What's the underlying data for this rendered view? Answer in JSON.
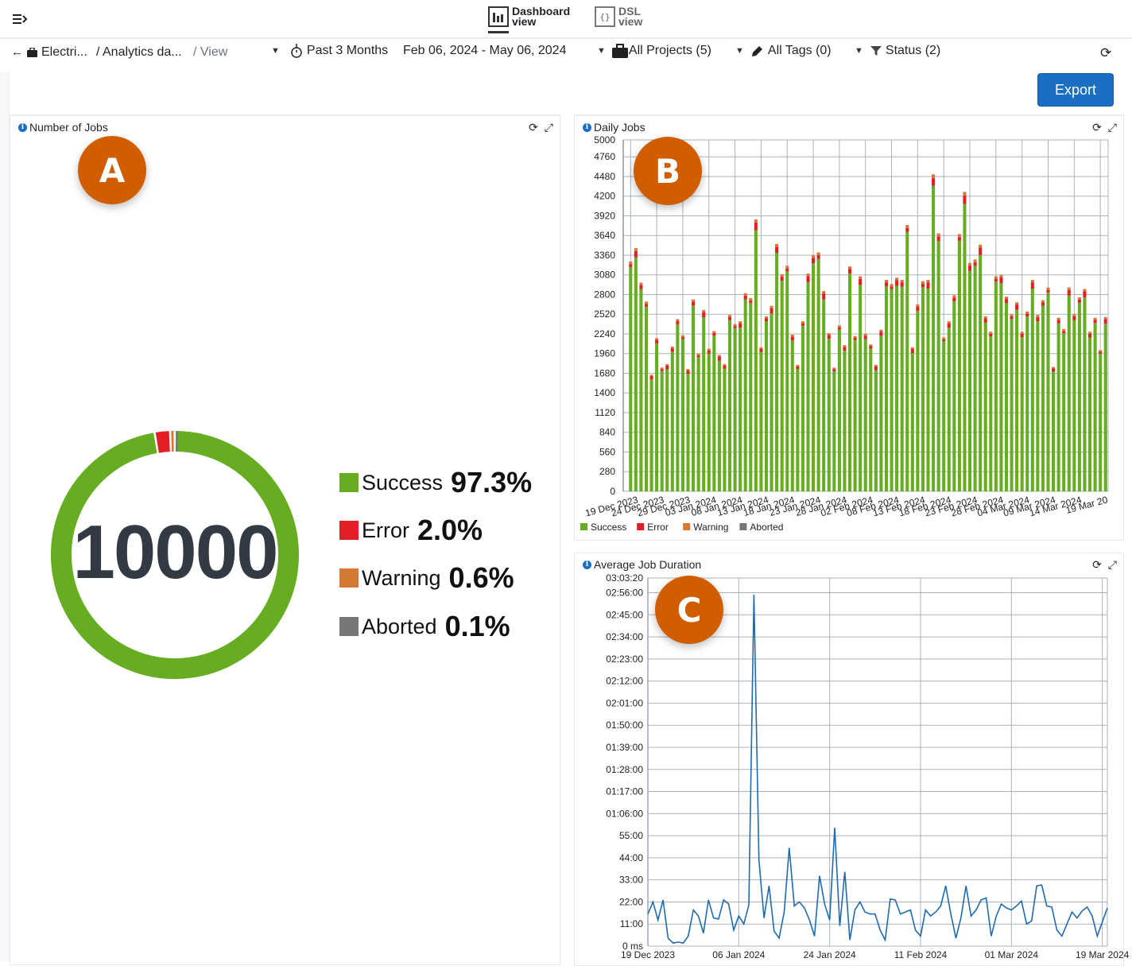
{
  "topbar": {
    "menu_icon": "menu-collapse-icon",
    "tabs": [
      {
        "label": "Dashboard\nview",
        "icon": "bar-chart-icon",
        "active": true
      },
      {
        "label": "DSL\nview",
        "icon": "code-braces-icon",
        "active": false
      }
    ]
  },
  "filterbar": {
    "back_icon": "arrow-left-icon",
    "breadcrumb": [
      {
        "label": "Electri...",
        "icon": "briefcase-icon"
      },
      {
        "label": "/ Analytics da..."
      },
      {
        "label": "/ View"
      }
    ],
    "time_range": {
      "label": "Past 3 Months",
      "icon": "stopwatch-icon",
      "dates": "Feb 06, 2024 - May 06, 2024"
    },
    "projects": {
      "label": "All Projects (5)",
      "icon": "briefcase-icon"
    },
    "tags": {
      "label": "All Tags (0)",
      "icon": "tag-icon"
    },
    "status": {
      "label": "Status (2)",
      "icon": "filter-icon"
    },
    "refresh_icon": "refresh-icon"
  },
  "export_label": "Export",
  "panels": {
    "number_of_jobs": {
      "title": "Number of Jobs",
      "badge": "A",
      "total": "10000",
      "legend": [
        {
          "label": "Success",
          "pct": "97.3%",
          "color": "#66ad22"
        },
        {
          "label": "Error",
          "pct": "2.0%",
          "color": "#e41e26"
        },
        {
          "label": "Warning",
          "pct": "0.6%",
          "color": "#d57834"
        },
        {
          "label": "Aborted",
          "pct": "0.1%",
          "color": "#777777"
        }
      ]
    },
    "daily_jobs": {
      "title": "Daily Jobs",
      "badge": "B"
    },
    "avg_duration": {
      "title": "Average Job Duration",
      "badge": "C"
    }
  },
  "chart_data": [
    {
      "type": "pie",
      "title": "Number of Jobs",
      "center_label": "10000",
      "categories": [
        "Success",
        "Error",
        "Warning",
        "Aborted"
      ],
      "values": [
        97.3,
        2.0,
        0.6,
        0.1
      ],
      "colors": [
        "#66ad22",
        "#e41e26",
        "#d57834",
        "#777777"
      ]
    },
    {
      "type": "bar",
      "stacked": true,
      "title": "Daily Jobs",
      "ylim": [
        0,
        5000
      ],
      "yticks": [
        0,
        280,
        560,
        840,
        1120,
        1400,
        1680,
        1960,
        2240,
        2520,
        2800,
        3080,
        3360,
        3640,
        3920,
        4200,
        4480,
        4760,
        5000
      ],
      "xtick_labels": [
        "19 Dec 2023",
        "24 Dec 2023",
        "29 Dec 2023",
        "03 Jan 2024",
        "08 Jan 2024",
        "13 Jan 2024",
        "18 Jan 2024",
        "23 Jan 2024",
        "28 Jan 2024",
        "02 Feb 2024",
        "08 Feb 2024",
        "13 Feb 2024",
        "18 Feb 2024",
        "23 Feb 2024",
        "28 Feb 2024",
        "04 Mar 2024",
        "09 Mar 2024",
        "14 Mar 2024",
        "19 Mar 20"
      ],
      "legend": [
        "Success",
        "Error",
        "Warning",
        "Aborted"
      ],
      "legend_position": "bottom-left",
      "colors": [
        "#66ad22",
        "#e41e26",
        "#d57834",
        "#777777"
      ],
      "totals": [
        3270,
        3460,
        2970,
        2700,
        1660,
        2180,
        1760,
        1810,
        2060,
        2450,
        2220,
        1740,
        2730,
        1960,
        2580,
        2030,
        2280,
        1940,
        1810,
        2510,
        2380,
        2420,
        2820,
        2750,
        3870,
        2050,
        2490,
        2640,
        3520,
        3090,
        3210,
        2230,
        1800,
        2420,
        3100,
        3360,
        3400,
        2850,
        2250,
        1760,
        2360,
        2080,
        3200,
        2210,
        3060,
        2240,
        2090,
        1800,
        2300,
        3010,
        2950,
        3040,
        3010,
        3790,
        2050,
        2660,
        2990,
        3010,
        4510,
        3670,
        2190,
        2420,
        2790,
        3660,
        4260,
        3250,
        3300,
        3510,
        2490,
        2270,
        3060,
        3080,
        2770,
        2520,
        2690,
        2270,
        2560,
        3010,
        2510,
        2720,
        2900,
        1770,
        2470,
        2310,
        2900,
        2520,
        2760,
        2880,
        2270,
        2470,
        2010,
        2480
      ],
      "error_share": 0.02,
      "warning_share": 0.006,
      "aborted_share": 0.001,
      "start_date": "19 Dec 2023"
    },
    {
      "type": "line",
      "title": "Average Job Duration",
      "ylim_seconds": [
        0,
        11000
      ],
      "yticks": [
        "0 ms",
        "11:00",
        "22:00",
        "33:00",
        "44:00",
        "55:00",
        "01:06:00",
        "01:17:00",
        "01:28:00",
        "01:39:00",
        "01:50:00",
        "02:01:00",
        "02:12:00",
        "02:23:00",
        "02:34:00",
        "02:45:00",
        "02:56:00",
        "03:03:20"
      ],
      "xtick_labels": [
        "19 Dec 2023",
        "06 Jan 2024",
        "24 Jan 2024",
        "11 Feb 2024",
        "01 Mar 2024",
        "19 Mar 2024"
      ],
      "series": [
        {
          "name": "Average Job Duration",
          "color": "#1f6bb0",
          "values_minutes": [
            16,
            22,
            13,
            23,
            4,
            1.5,
            2,
            1.5,
            5,
            18,
            15,
            6.5,
            23,
            14,
            13.5,
            23,
            21,
            8,
            15,
            11,
            20.5,
            175,
            43,
            14,
            30,
            7.5,
            4,
            17,
            49,
            20,
            22,
            19,
            13,
            5,
            35,
            21,
            13,
            59,
            10,
            37,
            3,
            18,
            22,
            17,
            16,
            16,
            8,
            3,
            23.5,
            23,
            16,
            17,
            18,
            8,
            5,
            18,
            15,
            17,
            20,
            30,
            16,
            4,
            14,
            30,
            15,
            18,
            23,
            24,
            5,
            15,
            21,
            19,
            18,
            20,
            22.5,
            11,
            12.5,
            30,
            30.5,
            20,
            19.5,
            8,
            5,
            11,
            17,
            14,
            17.5,
            19.5,
            15,
            5,
            12,
            19
          ]
        }
      ]
    }
  ]
}
